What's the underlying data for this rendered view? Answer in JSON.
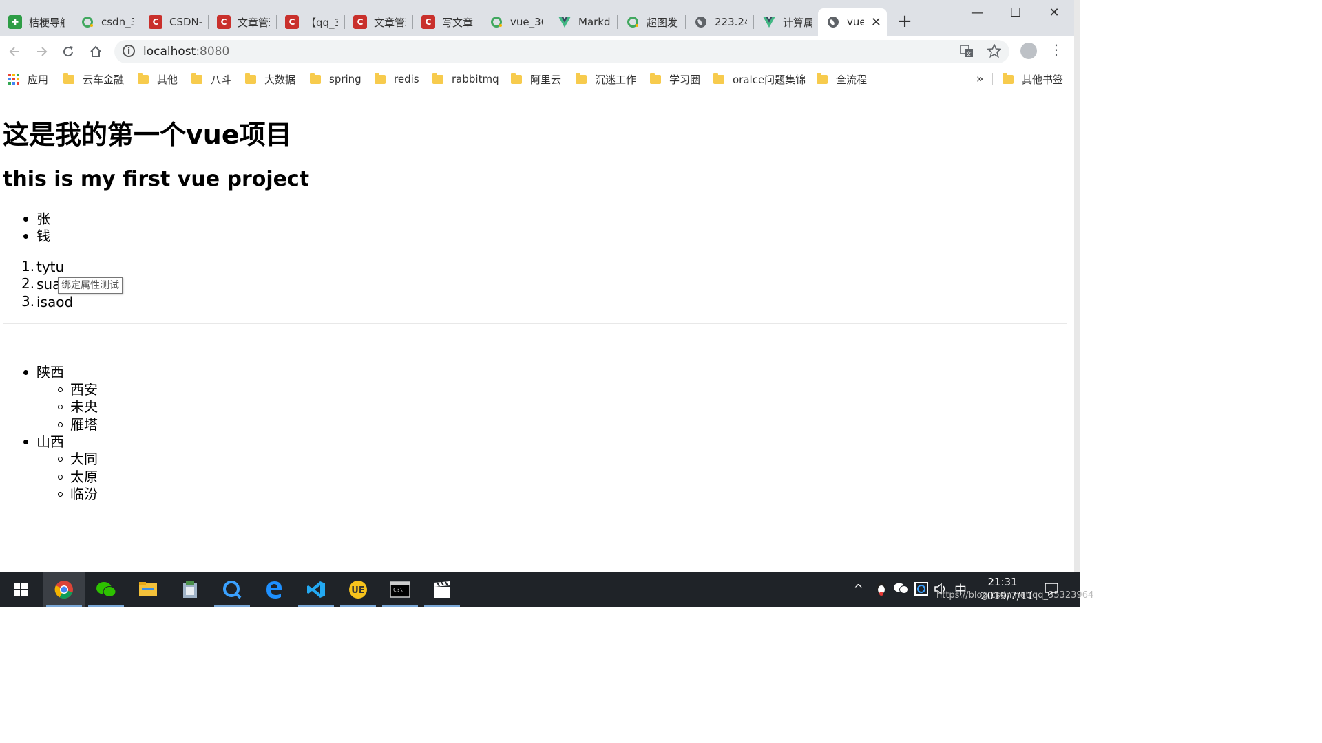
{
  "browser": {
    "tabs": [
      {
        "title": "桔梗导航",
        "favicon": "green-puzzle"
      },
      {
        "title": "csdn_3",
        "favicon": "green-ring"
      },
      {
        "title": "CSDN-",
        "favicon": "csdn-red"
      },
      {
        "title": "文章管理",
        "favicon": "csdn-red"
      },
      {
        "title": "【qq_3",
        "favicon": "csdn-red"
      },
      {
        "title": "文章管理",
        "favicon": "csdn-red"
      },
      {
        "title": "写文章",
        "favicon": "csdn-red"
      },
      {
        "title": "vue_36",
        "favicon": "green-ring"
      },
      {
        "title": "Markd",
        "favicon": "vue-v"
      },
      {
        "title": "超图发",
        "favicon": "green-ring"
      },
      {
        "title": "223.24",
        "favicon": "globe"
      },
      {
        "title": "计算属",
        "favicon": "vue-v"
      },
      {
        "title": "vue",
        "favicon": "globe",
        "active": true
      }
    ],
    "new_tab": "+",
    "window_controls": {
      "minimize": "—",
      "maximize": "☐",
      "close": "✕"
    },
    "address": {
      "host": "localhost",
      "port": ":8080"
    },
    "bookmarks": [
      {
        "label": "应用",
        "type": "apps"
      },
      {
        "label": "云车金融",
        "type": "folder"
      },
      {
        "label": "其他",
        "type": "folder"
      },
      {
        "label": "八斗",
        "type": "folder"
      },
      {
        "label": "大数据",
        "type": "folder"
      },
      {
        "label": "spring",
        "type": "folder"
      },
      {
        "label": "redis",
        "type": "folder"
      },
      {
        "label": "rabbitmq",
        "type": "folder"
      },
      {
        "label": "阿里云",
        "type": "folder"
      },
      {
        "label": "沉迷工作",
        "type": "folder"
      },
      {
        "label": "学习圈",
        "type": "folder"
      },
      {
        "label": "oralce问题集锦",
        "type": "folder"
      },
      {
        "label": "全流程",
        "type": "folder"
      }
    ],
    "bookmarks_overflow": "»",
    "other_bookmarks": "其他书签"
  },
  "page": {
    "heading1": "这是我的第一个vue项目",
    "heading2": "this is my first vue project",
    "unordered_list": [
      "张",
      "钱"
    ],
    "ordered_list": [
      "tytu",
      "sua",
      "isaod"
    ],
    "tooltip": "绑定属性测试",
    "provinces": [
      {
        "name": "陕西",
        "cities": [
          "西安",
          "未央",
          "雁塔"
        ]
      },
      {
        "name": "山西",
        "cities": [
          "大同",
          "太原",
          "临汾"
        ]
      }
    ]
  },
  "taskbar": {
    "apps": [
      "start",
      "chrome",
      "wechat",
      "file-explorer",
      "app-manager",
      "qq-browser",
      "edge",
      "vscode",
      "ultraedit",
      "terminal",
      "media-app"
    ],
    "time": "21:31",
    "date": "2019/7/11",
    "ime": "中",
    "watermark": "https://blog.csdn.net/qq_35323964"
  },
  "colors": {
    "tabstrip": "#dee1e6",
    "taskbar": "#1f2328",
    "csdn_red": "#c9302c",
    "vue_green": "#41b883"
  }
}
